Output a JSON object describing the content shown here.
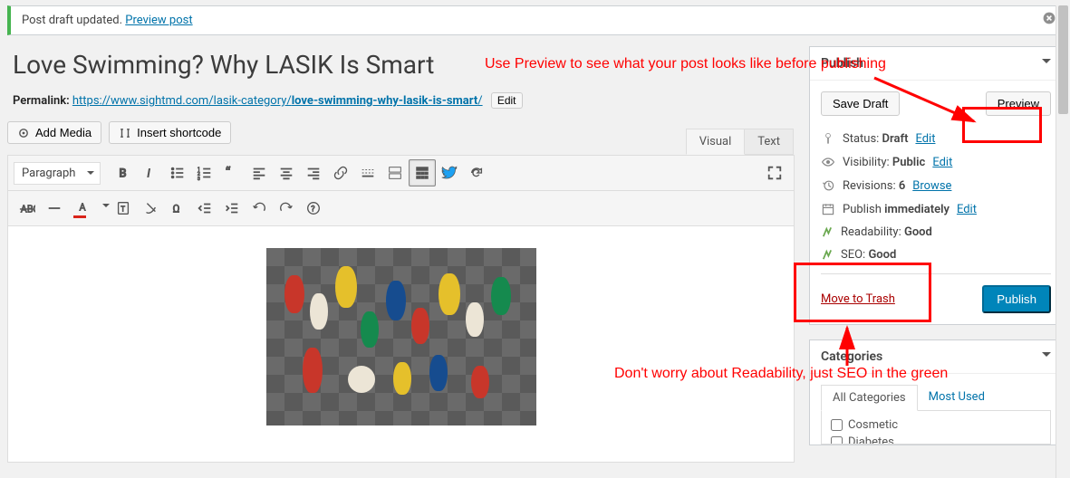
{
  "notice": {
    "text": "Post draft updated. ",
    "link": "Preview post"
  },
  "title": "Love Swimming? Why LASIK Is Smart",
  "permalink": {
    "label": "Permalink:",
    "base": "https://www.sightmd.com/lasik-category/",
    "slug": "love-swimming-why-lasik-is-smart",
    "trail": "/",
    "edit": "Edit"
  },
  "media": {
    "add_media": "Add Media",
    "insert_shortcode": "Insert shortcode"
  },
  "tabs": {
    "visual": "Visual",
    "text": "Text"
  },
  "format_select": "Paragraph",
  "publish_box": {
    "heading": "Publish",
    "save_draft": "Save Draft",
    "preview": "Preview",
    "status_label": "Status: ",
    "status_value": "Draft",
    "visibility_label": "Visibility: ",
    "visibility_value": "Public",
    "revisions_label": "Revisions: ",
    "revisions_value": "6",
    "browse": "Browse",
    "publish_label": "Publish ",
    "publish_value": "immediately",
    "readability_label": "Readability: ",
    "readability_value": "Good",
    "seo_label": "SEO: ",
    "seo_value": "Good",
    "edit": "Edit",
    "move_trash": "Move to Trash",
    "publish_btn": "Publish"
  },
  "categories": {
    "heading": "Categories",
    "tabs": {
      "all": "All Categories",
      "most": "Most Used"
    },
    "items": [
      "Cosmetic",
      "Diabetes"
    ]
  },
  "annotations": {
    "top": "Use Preview to see what your post looks like before publishing",
    "bottom": "Don't worry about Readability, just SEO in the green"
  }
}
